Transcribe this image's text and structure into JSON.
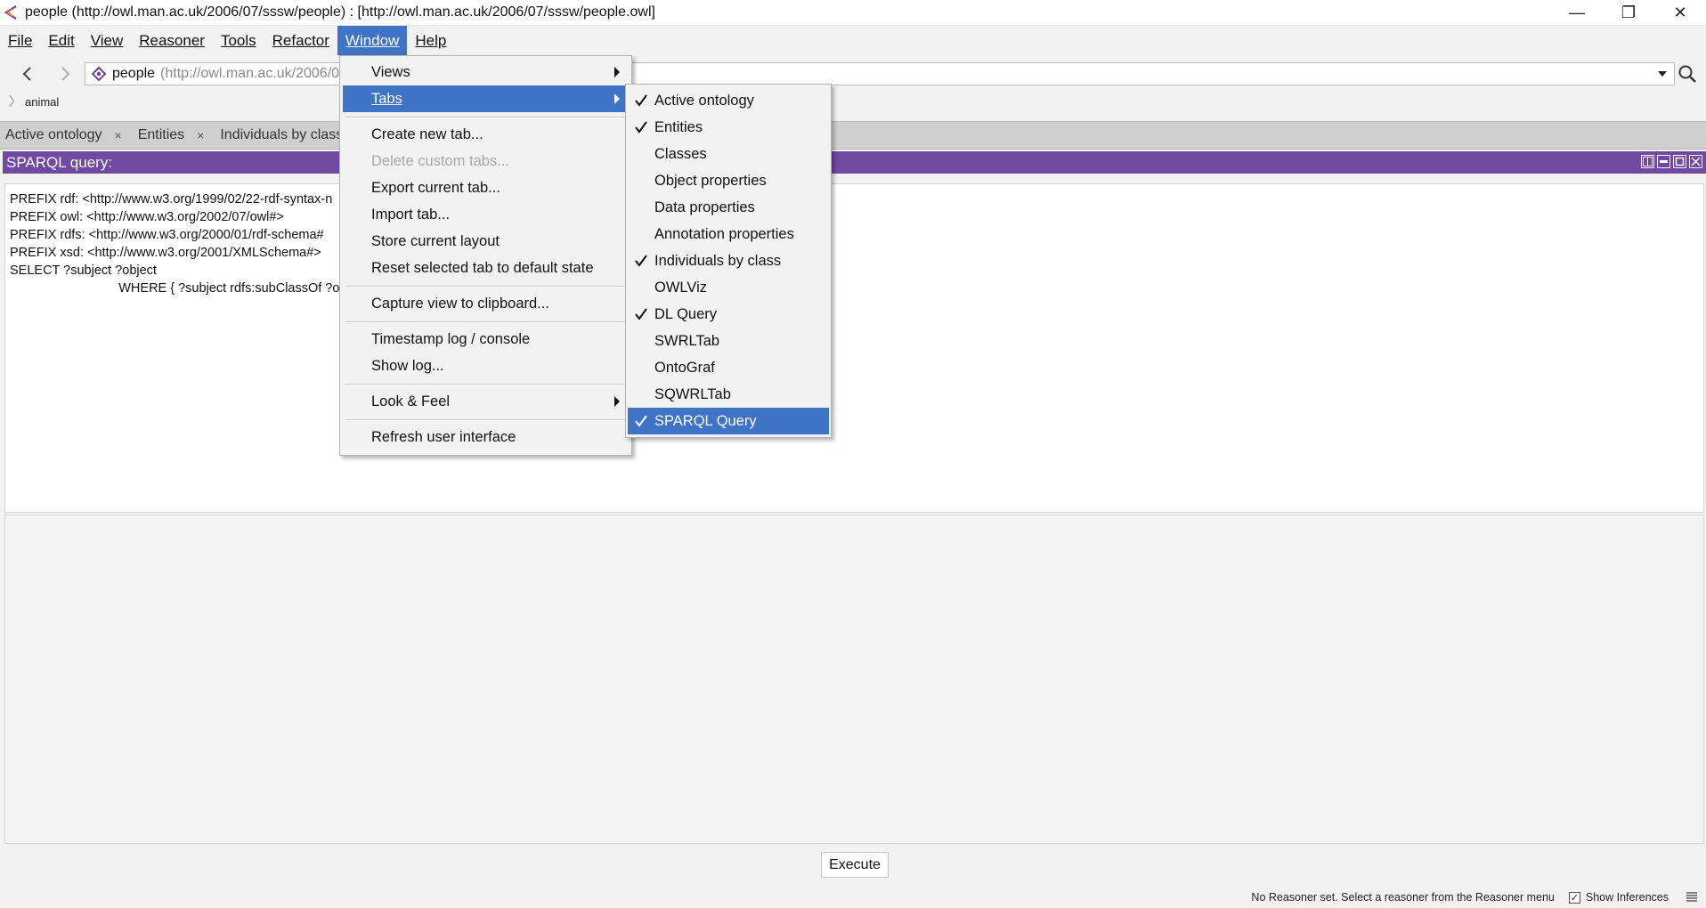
{
  "window": {
    "title": "people (http://owl.man.ac.uk/2006/07/sssw/people)  : [http://owl.man.ac.uk/2006/07/sssw/people.owl]",
    "minimize": "—",
    "maximize": "❐",
    "close": "✕"
  },
  "menubar": {
    "items": [
      {
        "label": "File"
      },
      {
        "label": "Edit"
      },
      {
        "label": "View"
      },
      {
        "label": "Reasoner"
      },
      {
        "label": "Tools"
      },
      {
        "label": "Refactor"
      },
      {
        "label": "Window",
        "active": true
      },
      {
        "label": "Help"
      }
    ]
  },
  "toolbar": {
    "ontology_name": "people",
    "ontology_uri": "(http://owl.man.ac.uk/2006/0",
    "back_icon": "chevron-left-icon",
    "forward_icon": "chevron-right-icon",
    "search_icon": "search-icon"
  },
  "breadcrumb": {
    "item": "animal"
  },
  "tabs": [
    {
      "label": "Active ontology"
    },
    {
      "label": "Entities"
    },
    {
      "label": "Individuals by class"
    }
  ],
  "view": {
    "title": "SPARQL query:",
    "query_lines": [
      "PREFIX rdf: <http://www.w3.org/1999/02/22-rdf-syntax-n",
      "PREFIX owl: <http://www.w3.org/2002/07/owl#>",
      "PREFIX rdfs: <http://www.w3.org/2000/01/rdf-schema#",
      "PREFIX xsd: <http://www.w3.org/2001/XMLSchema#>",
      "SELECT ?subject ?object",
      "\tWHERE { ?subject rdfs:subClassOf ?obj"
    ],
    "execute_label": "Execute"
  },
  "window_menu": {
    "items": [
      {
        "label": "Views",
        "submenu": true
      },
      {
        "label": "Tabs",
        "submenu": true,
        "highlight": true
      },
      {
        "label": "Create new tab..."
      },
      {
        "label": "Delete custom tabs...",
        "disabled": true
      },
      {
        "label": "Export current tab..."
      },
      {
        "label": "Import tab..."
      },
      {
        "label": "Store current layout"
      },
      {
        "label": "Reset selected tab to default state"
      },
      {
        "label": "Capture view to clipboard..."
      },
      {
        "label": "Timestamp log / console"
      },
      {
        "label": "Show log..."
      },
      {
        "label": "Look & Feel",
        "submenu": true
      },
      {
        "label": "Refresh user interface"
      }
    ]
  },
  "tabs_submenu": {
    "items": [
      {
        "label": "Active ontology",
        "checked": true
      },
      {
        "label": "Entities",
        "checked": true
      },
      {
        "label": "Classes",
        "checked": false
      },
      {
        "label": "Object properties",
        "checked": false
      },
      {
        "label": "Data properties",
        "checked": false
      },
      {
        "label": "Annotation properties",
        "checked": false
      },
      {
        "label": "Individuals by class",
        "checked": true
      },
      {
        "label": "OWLViz",
        "checked": false
      },
      {
        "label": "DL Query",
        "checked": true
      },
      {
        "label": "SWRLTab",
        "checked": false
      },
      {
        "label": "OntoGraf",
        "checked": false
      },
      {
        "label": "SQWRLTab",
        "checked": false
      },
      {
        "label": "SPARQL Query",
        "checked": true,
        "highlight": true
      }
    ]
  },
  "statusbar": {
    "message": "No Reasoner set. Select a reasoner from the Reasoner menu",
    "show_inferences_label": "Show Inferences",
    "show_inferences_checked": true
  },
  "colors": {
    "menu_highlight": "#3f73c6",
    "view_header": "#7049a0"
  }
}
